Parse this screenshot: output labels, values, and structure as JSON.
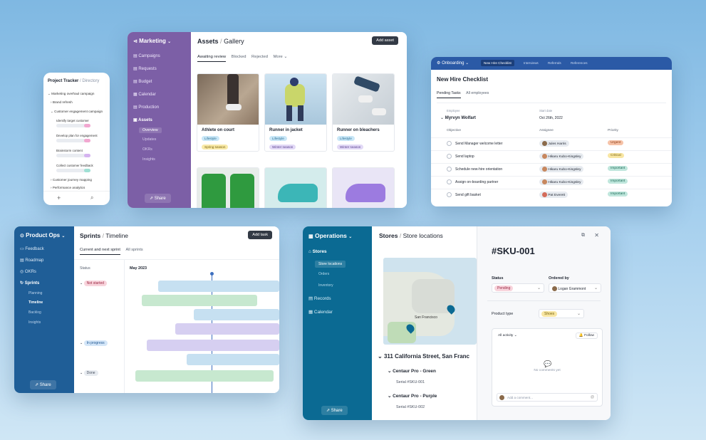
{
  "mobile": {
    "title": "Project Tracker",
    "crumb": "Directory",
    "rows": [
      "Marketing overhaul campaign",
      "Brand refresh",
      "Customer engagement campaign",
      "Identify target customer",
      "Develop plan for engagement",
      "Brainstorm content",
      "Collect customer feedback",
      "Customer journey mapping",
      "Performance analytics"
    ],
    "add": "+",
    "search": "⌕"
  },
  "marketing": {
    "app": "Marketing",
    "nav": [
      "Campaigns",
      "Requests",
      "Budget",
      "Calendar",
      "Production",
      "Assets"
    ],
    "subnav": [
      "Overview",
      "Updates",
      "OKRs",
      "Insights"
    ],
    "share": "Share",
    "title": "Assets",
    "crumb": "Gallery",
    "add_button": "Add asset",
    "tabs": [
      "Awaiting review",
      "Blocked",
      "Rejected",
      "More"
    ],
    "cards": [
      {
        "title": "Athlete on court",
        "tags": [
          "Lifestyle",
          "Spring season"
        ]
      },
      {
        "title": "Runner in jacket",
        "tags": [
          "Lifestyle",
          "Winter season"
        ]
      },
      {
        "title": "Runner on bleachers",
        "tags": [
          "Lifestyle",
          "Winter season"
        ]
      }
    ]
  },
  "onboarding": {
    "app": "Onboarding",
    "tabs": [
      "New Hire Checklist",
      "Interviews",
      "Referrals",
      "References"
    ],
    "title": "New Hire Checklist",
    "subtabs": [
      "Pending Tasks",
      "All employees"
    ],
    "employee_label": "Employee",
    "employee": "Myrvyn Wolfart",
    "start_label": "Start date",
    "start_date": "Oct 26th, 2022",
    "cols": [
      "Objective",
      "Assignee",
      "Priority"
    ],
    "rows": [
      {
        "task": "Send Manager welcome letter",
        "assignee": "Jules Harris",
        "priority": "Urgent"
      },
      {
        "task": "Send laptop",
        "assignee": "Hikaru Kubo-Kingsley",
        "priority": "Critical"
      },
      {
        "task": "Schedule new-hire orientation",
        "assignee": "Hikaru Kubo-Kingsley",
        "priority": "Important"
      },
      {
        "task": "Assign on-boarding partner",
        "assignee": "Hikaru Kubo-Kingsley",
        "priority": "Important"
      },
      {
        "task": "Send gift basket",
        "assignee": "Pat Everett",
        "priority": "Important"
      }
    ]
  },
  "productops": {
    "app": "Product Ops",
    "nav": [
      "Feedback",
      "Roadmap",
      "OKRs",
      "Sprints"
    ],
    "subnav": [
      "Planning",
      "Timeline",
      "Backlog",
      "Insights"
    ],
    "share": "Share",
    "title": "Sprints",
    "crumb": "Timeline",
    "add_button": "Add task",
    "tabs": [
      "Current and next sprint",
      "All sprints"
    ],
    "status_col": "Status",
    "month": "May 2023",
    "groups": [
      "Not started",
      "In progress",
      "Done"
    ]
  },
  "operations": {
    "app": "Operations",
    "nav": [
      "Stores",
      "Records",
      "Calendar"
    ],
    "subnav": [
      "Store locations",
      "Orders",
      "Inventory"
    ],
    "share": "Share",
    "title": "Stores",
    "crumb": "Store locations",
    "map_label": "San Francisco",
    "address": "311 California Street, San Franc",
    "products": [
      {
        "name": "Centaur Pro - Green",
        "serial": "Serial #SKU-001"
      },
      {
        "name": "Centaur Pro - Purple",
        "serial": "Serial #SKU-002"
      }
    ],
    "detail": {
      "sku": "#SKU-001",
      "status_label": "Status",
      "status": "Pending",
      "ordered_label": "Ordered by",
      "ordered_by": "Logan Grammont",
      "type_label": "Product type",
      "type": "Shoes",
      "activity": "All activity",
      "follow": "Follow",
      "no_comments": "No comments yet",
      "comment_placeholder": "Add a comment..."
    }
  }
}
